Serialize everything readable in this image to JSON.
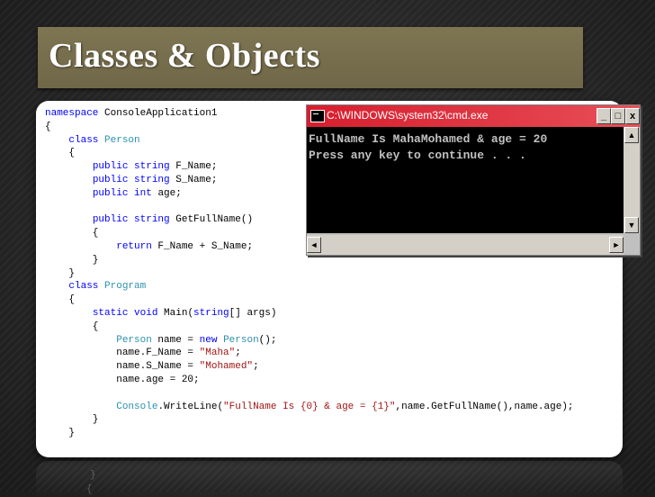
{
  "slide": {
    "title": "Classes & Objects"
  },
  "code": {
    "lines": [
      "namespace ConsoleApplication1",
      "{",
      "    class Person",
      "    {",
      "        public string F_Name;",
      "        public string S_Name;",
      "        public int age;",
      "",
      "        public string GetFullName()",
      "        {",
      "            return F_Name + S_Name;",
      "        }",
      "    }",
      "    class Program",
      "    {",
      "        static void Main(string[] args)",
      "        {",
      "            Person name = new Person();",
      "            name.F_Name = \"Maha\";",
      "            name.S_Name = \"Mohamed\";",
      "            name.age = 20;",
      "",
      "            Console.WriteLine(\"FullName Is {0} & age = {1}\",name.GetFullName(),name.age);",
      "        }",
      "    }"
    ]
  },
  "console": {
    "title": "C:\\WINDOWS\\system32\\cmd.exe",
    "output_line1": "FullName Is MahaMohamed & age = 20",
    "output_line2": "Press any key to continue . . .",
    "minimize": "_",
    "maximize": "□",
    "close": "x"
  },
  "colors": {
    "title_bar": "#7e7553",
    "keyword": "#0000ff",
    "type": "#2b91af",
    "string": "#a31515",
    "console_title": "#d81e2e"
  }
}
